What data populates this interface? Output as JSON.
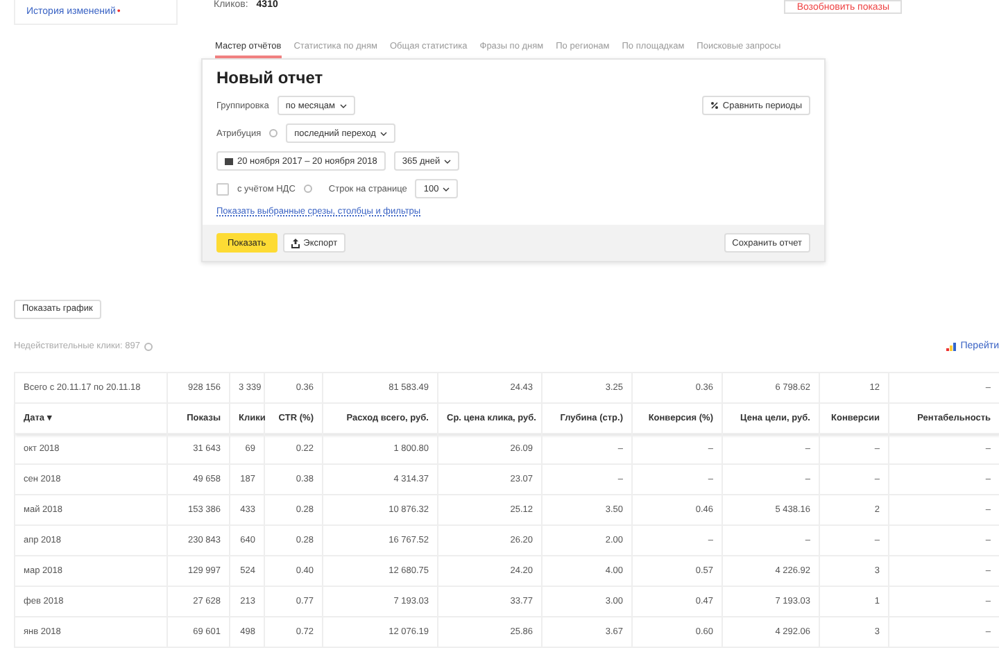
{
  "sidebar": {
    "link": "История изменений",
    "link_dot": "•"
  },
  "summary": {
    "label": "Кликов:",
    "value": "4310"
  },
  "resume_button": "Возобновить показы",
  "tabs": [
    {
      "label": "Мастер отчётов",
      "selected": true
    },
    {
      "label": "Статистика по дням",
      "selected": false
    },
    {
      "label": "Общая статистика",
      "selected": false
    },
    {
      "label": "Фразы по дням",
      "selected": false
    },
    {
      "label": "По регионам",
      "selected": false
    },
    {
      "label": "По площадкам",
      "selected": false
    },
    {
      "label": "Поисковые запросы",
      "selected": false
    }
  ],
  "report": {
    "title": "Новый отчет",
    "grouping": {
      "label": "Группировка",
      "value": "по месяцам"
    },
    "compare_button": "Сравнить периоды",
    "attribution": {
      "label": "Атрибуция",
      "value": "последний переход"
    },
    "date_range": "20 ноября 2017 – 20 ноября 2018",
    "period": "365 дней",
    "vat": {
      "label": "с учётом НДС",
      "checked": false
    },
    "rows_per_page": {
      "label": "Строк на странице",
      "value": "100"
    },
    "filters_link": "Показать выбранные срезы, столбцы и фильтры",
    "show_button": "Показать",
    "export_button": "Экспорт",
    "save_button": "Сохранить отчет"
  },
  "chart_button": "Показать график",
  "invalid_clicks": "Недействительные клики: 897",
  "goto_link": "Перейти",
  "table": {
    "columns": [
      "Дата ▾",
      "Показы",
      "Клики",
      "CTR (%)",
      "Расход всего, руб.",
      "Ср. цена клика, руб.",
      "Глубина (стр.)",
      "Конверсия (%)",
      "Цена цели, руб.",
      "Конверсии",
      "Рентабельность"
    ],
    "total": [
      "Всего с 20.11.17 по 20.11.18",
      "928 156",
      "3 339",
      "0.36",
      "81 583.49",
      "24.43",
      "3.25",
      "0.36",
      "6 798.62",
      "12",
      "–"
    ],
    "rows": [
      [
        "окт 2018",
        "31 643",
        "69",
        "0.22",
        "1 800.80",
        "26.09",
        "–",
        "–",
        "–",
        "–",
        "–"
      ],
      [
        "сен 2018",
        "49 658",
        "187",
        "0.38",
        "4 314.37",
        "23.07",
        "–",
        "–",
        "–",
        "–",
        "–"
      ],
      [
        "май 2018",
        "153 386",
        "433",
        "0.28",
        "10 876.32",
        "25.12",
        "3.50",
        "0.46",
        "5 438.16",
        "2",
        "–"
      ],
      [
        "апр 2018",
        "230 843",
        "640",
        "0.28",
        "16 767.52",
        "26.20",
        "2.00",
        "–",
        "–",
        "–",
        "–"
      ],
      [
        "мар 2018",
        "129 997",
        "524",
        "0.40",
        "12 680.75",
        "24.20",
        "4.00",
        "0.57",
        "4 226.92",
        "3",
        "–"
      ],
      [
        "фев 2018",
        "27 628",
        "213",
        "0.77",
        "7 193.03",
        "33.77",
        "3.00",
        "0.47",
        "7 193.03",
        "1",
        "–"
      ],
      [
        "янв 2018",
        "69 601",
        "498",
        "0.72",
        "12 076.19",
        "25.86",
        "3.67",
        "0.60",
        "4 292.06",
        "3",
        "–"
      ]
    ]
  }
}
